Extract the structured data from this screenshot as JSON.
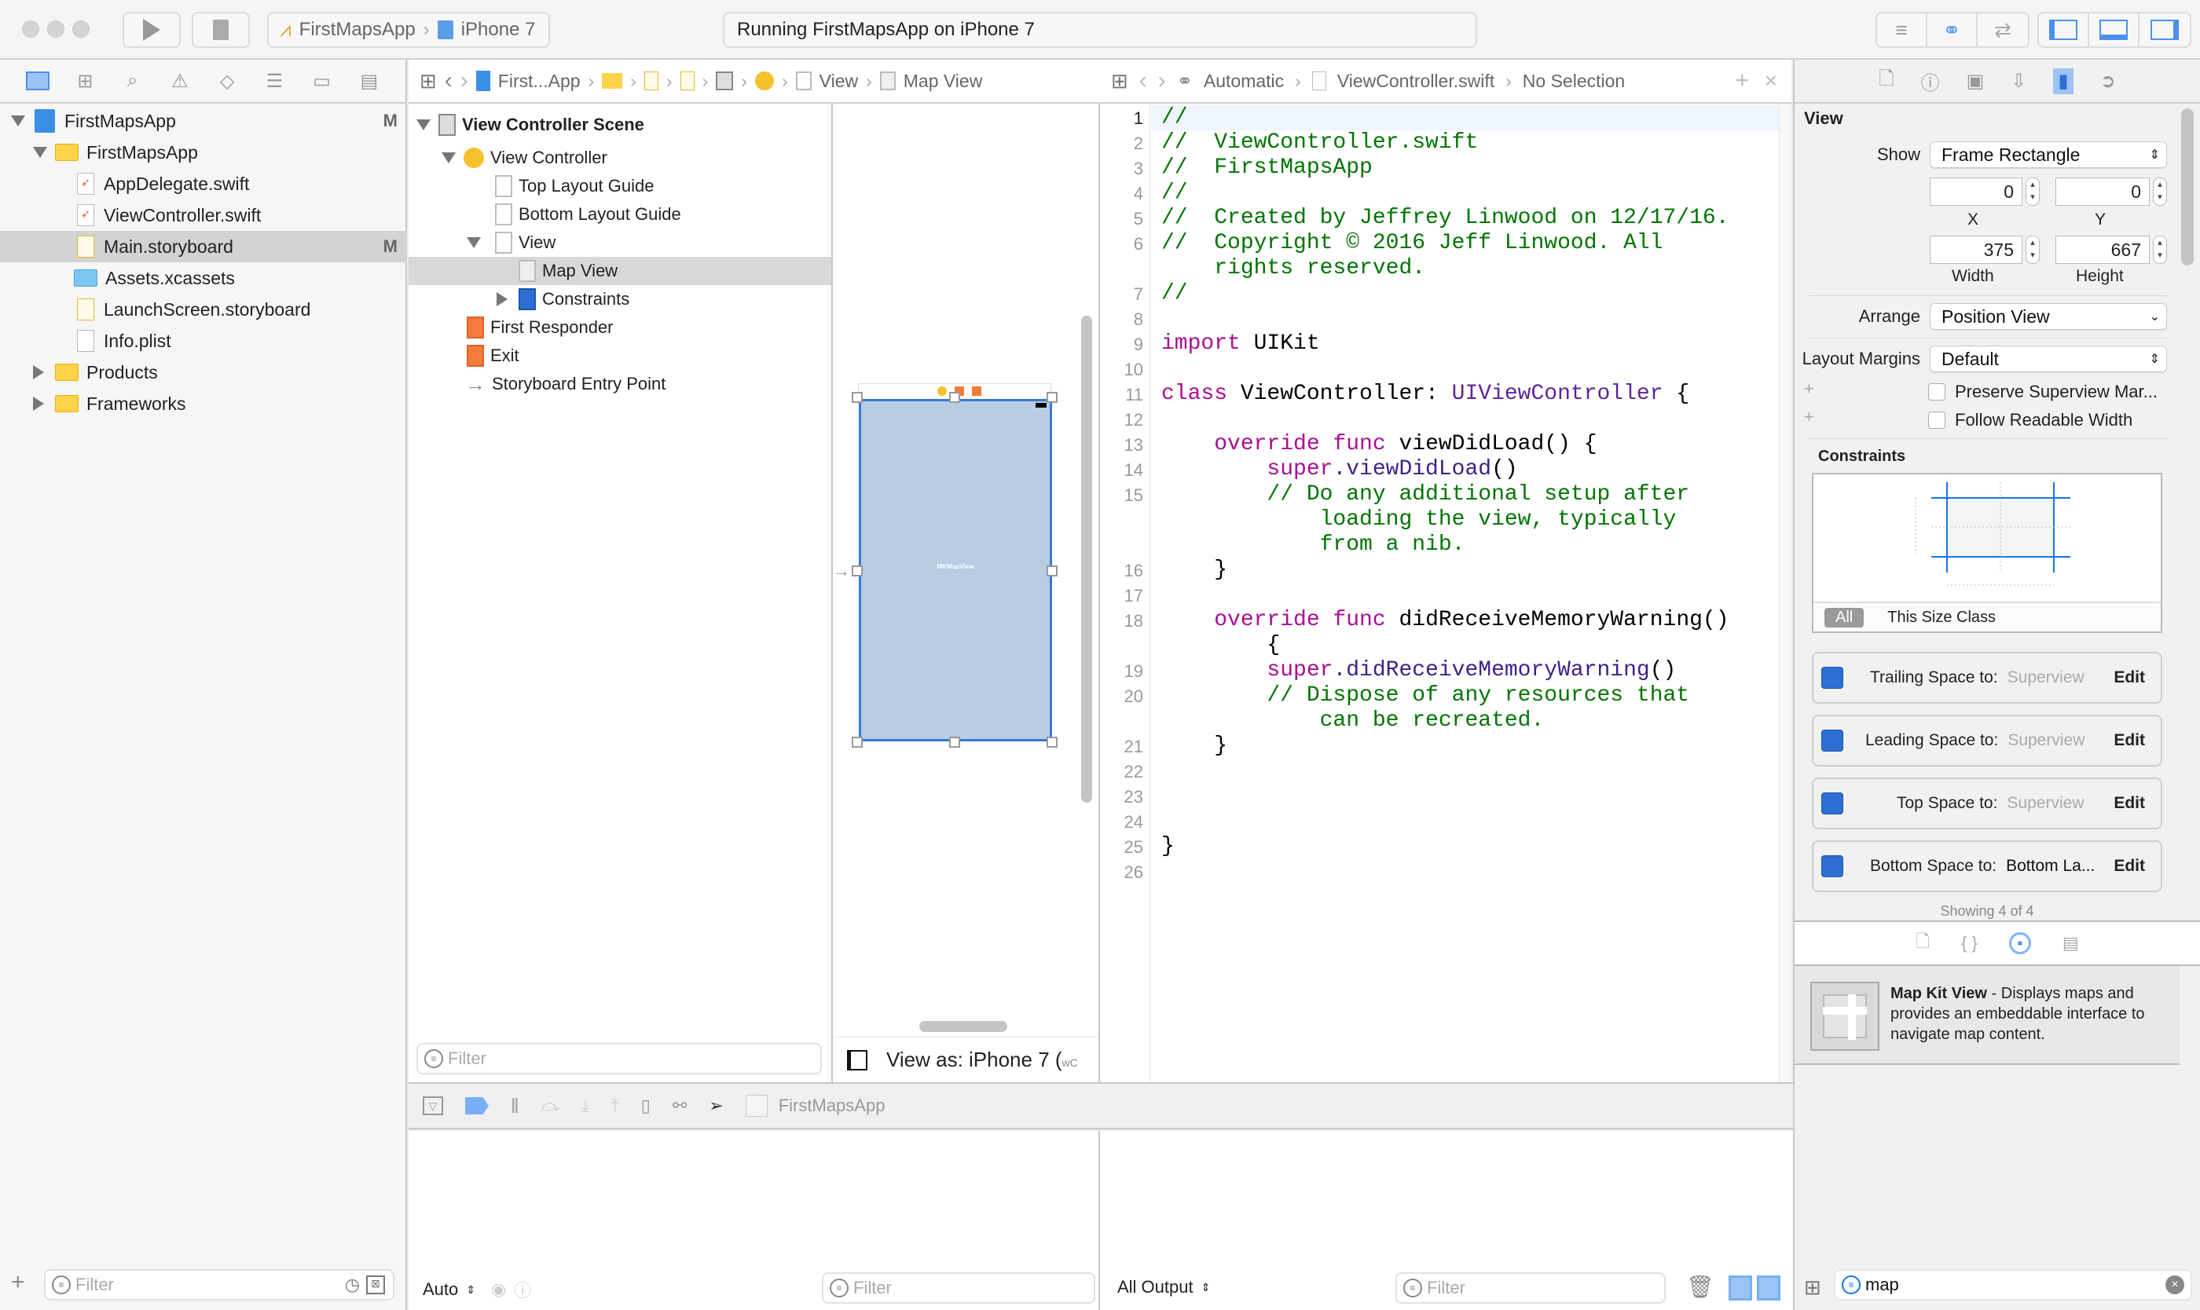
{
  "toolbar": {
    "scheme": "FirstMapsApp",
    "destination": "iPhone 7",
    "status": "Running FirstMapsApp on iPhone 7",
    "run_icon": "play-icon",
    "stop_icon": "stop-icon"
  },
  "navigator": {
    "tabs": [
      "folder-icon",
      "hierarchy-icon",
      "search-icon",
      "warning-icon",
      "test-diamond-icon",
      "debug-list-icon",
      "breakpoint-icon",
      "report-icon"
    ],
    "items": [
      {
        "label": "FirstMapsApp",
        "badge": "M",
        "level": 0,
        "expanded": true,
        "kind": "project"
      },
      {
        "label": "FirstMapsApp",
        "badge": "",
        "level": 1,
        "expanded": true,
        "kind": "folder"
      },
      {
        "label": "AppDelegate.swift",
        "badge": "",
        "level": 2,
        "kind": "swift"
      },
      {
        "label": "ViewController.swift",
        "badge": "",
        "level": 2,
        "kind": "swift"
      },
      {
        "label": "Main.storyboard",
        "badge": "M",
        "level": 2,
        "kind": "storyboard",
        "selected": true
      },
      {
        "label": "Assets.xcassets",
        "badge": "",
        "level": 2,
        "kind": "assets"
      },
      {
        "label": "LaunchScreen.storyboard",
        "badge": "",
        "level": 2,
        "kind": "storyboard"
      },
      {
        "label": "Info.plist",
        "badge": "",
        "level": 2,
        "kind": "plist"
      },
      {
        "label": "Products",
        "badge": "",
        "level": 1,
        "expanded": false,
        "kind": "folder"
      },
      {
        "label": "Frameworks",
        "badge": "",
        "level": 1,
        "expanded": false,
        "kind": "folder"
      }
    ],
    "filter_placeholder": "Filter"
  },
  "ib_jumpbar": {
    "items": [
      "First...App",
      "View",
      "Map View"
    ]
  },
  "outline": {
    "items": [
      {
        "label": "View Controller Scene",
        "bold": true
      },
      {
        "label": "View Controller"
      },
      {
        "label": "Top Layout Guide"
      },
      {
        "label": "Bottom Layout Guide"
      },
      {
        "label": "View"
      },
      {
        "label": "Map View",
        "selected": true
      },
      {
        "label": "Constraints"
      },
      {
        "label": "First Responder"
      },
      {
        "label": "Exit"
      },
      {
        "label": "Storyboard Entry Point"
      }
    ],
    "filter_placeholder": "Filter"
  },
  "canvas": {
    "map_view_label": "MKMapView",
    "view_as": "View as: iPhone 7 (",
    "view_as_suffix": "wC",
    "map_color": "#b8cce4"
  },
  "editor": {
    "jumpbar": {
      "mode": "Automatic",
      "file": "ViewController.swift",
      "selection": "No Selection"
    },
    "line_numbers": [
      "1",
      "2",
      "3",
      "4",
      "5",
      "6",
      "7",
      "8",
      "9",
      "10",
      "11",
      "12",
      "13",
      "14",
      "15",
      "16",
      "17",
      "18",
      "19",
      "20",
      "21",
      "22",
      "23",
      "24",
      "25",
      "26"
    ],
    "code": {
      "l1": "//",
      "l2": "//  ViewController.swift",
      "l3": "//  FirstMapsApp",
      "l4": "//",
      "l5": "//  Created by Jeffrey Linwood on 12/17/16.",
      "l6a": "//  Copyright © 2016 Jeff Linwood. All",
      "l6b": "    rights reserved.",
      "l7": "//",
      "l9kw": "import",
      "l9": " UIKit",
      "l11kw": "class",
      "l11a": " ViewController: ",
      "l11ty": "UIViewController",
      "l11b": " {",
      "l13kw": "    override func",
      "l13": " viewDidLoad() {",
      "l14kw": "        super",
      "l14fn": ".viewDidLoad",
      "l14": "()",
      "l15a": "        // Do any additional setup after",
      "l15b": "            loading the view, typically",
      "l15c": "            from a nib.",
      "l16": "    }",
      "l18kw": "    override func",
      "l18": " didReceiveMemoryWarning()",
      "l18b": "        {",
      "l19kw": "        super",
      "l19fn": ".didReceiveMemoryWarning",
      "l19": "()",
      "l20a": "        // Dispose of any resources that",
      "l20b": "            can be recreated.",
      "l21": "    }",
      "l24": "}"
    }
  },
  "inspector": {
    "section_title": "View",
    "show_label": "Show",
    "show_value": "Frame Rectangle",
    "x": "0",
    "y": "0",
    "width": "375",
    "height": "667",
    "x_label": "X",
    "y_label": "Y",
    "width_label": "Width",
    "height_label": "Height",
    "arrange_label": "Arrange",
    "arrange_value": "Position View",
    "margins_label": "Layout Margins",
    "margins_value": "Default",
    "preserve_label": "Preserve Superview Mar...",
    "readable_label": "Follow Readable Width",
    "constraints_title": "Constraints",
    "all_label": "All",
    "size_class_label": "This Size Class",
    "constraints": [
      {
        "label": "Trailing Space to:",
        "target": "Superview",
        "edit": "Edit"
      },
      {
        "label": "Leading Space to:",
        "target": "Superview",
        "edit": "Edit"
      },
      {
        "label": "Top Space to:",
        "target": "Superview",
        "edit": "Edit"
      },
      {
        "label": "Bottom Space to:",
        "target": "Bottom La...",
        "edit": "Edit"
      }
    ],
    "showing": "Showing 4 of 4"
  },
  "library": {
    "item_title": "Map Kit View",
    "item_desc": " - Displays maps and provides an embeddable interface to navigate map content.",
    "filter_value": "map"
  },
  "debug": {
    "process": "FirstMapsApp",
    "auto_label": "Auto",
    "output_label": "All Output",
    "filter_placeholder": "Filter"
  }
}
